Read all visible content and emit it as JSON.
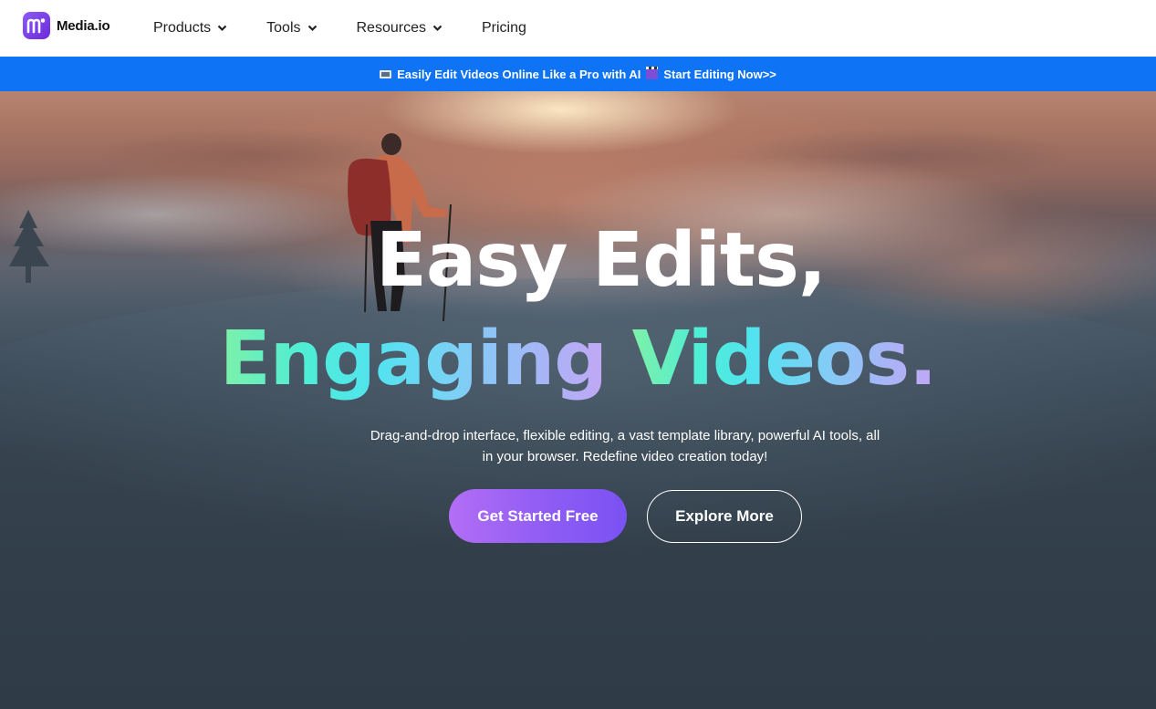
{
  "header": {
    "brand": "Media.io",
    "nav": [
      {
        "label": "Products",
        "has_dropdown": true
      },
      {
        "label": "Tools",
        "has_dropdown": true
      },
      {
        "label": "Resources",
        "has_dropdown": true
      },
      {
        "label": "Pricing",
        "has_dropdown": false
      }
    ]
  },
  "banner": {
    "text_1": "Easily Edit Videos Online Like a Pro with AI",
    "text_2": "Start Editing Now>>",
    "background": "#0f73f6"
  },
  "hero": {
    "headline_line1": "Easy Edits,",
    "headline_word_1": "Engaging",
    "headline_word_2": "Videos.",
    "subtitle_line1": "Drag-and-drop interface, flexible editing, a vast template library, powerful AI tools, all",
    "subtitle_line2": "in your browser. Redefine video creation today!",
    "primary_cta": "Get Started Free",
    "secondary_cta": "Explore More",
    "accent": "#8f5cf4"
  },
  "icons": {
    "logo": "media-io-logo-icon",
    "dropdown": "chevron-down-icon",
    "banner_left": "film-frames-icon",
    "banner_right": "clapperboard-icon"
  }
}
